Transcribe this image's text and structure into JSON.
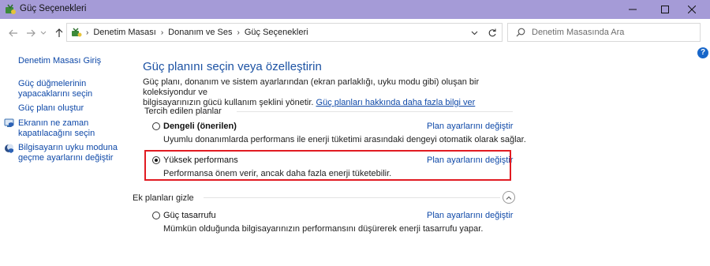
{
  "window": {
    "title": "Güç Seçenekleri"
  },
  "nav": {
    "breadcrumbs": [
      "Denetim Masası",
      "Donanım ve Ses",
      "Güç Seçenekleri"
    ],
    "search_placeholder": "Denetim Masasında Ara"
  },
  "sidebar": {
    "home": "Denetim Masası Giriş",
    "items": [
      {
        "line1": "Güç düğmelerinin",
        "line2": "yapacaklarını seçin"
      },
      {
        "line1": "Güç planı oluştur",
        "line2": ""
      },
      {
        "line1": "Ekranın ne zaman",
        "line2": "kapatılacağını seçin"
      },
      {
        "line1": "Bilgisayarın uyku moduna",
        "line2": "geçme ayarlarını değiştir"
      }
    ]
  },
  "main": {
    "title": "Güç planını seçin veya özelleştirin",
    "desc_line1": "Güç planı, donanım ve sistem ayarlarından (ekran parlaklığı, uyku modu gibi) oluşan bir koleksiyondur ve",
    "desc_line2": "bilgisayarınızın gücü kullanım şeklini yönetir.",
    "desc_link": "Güç planları hakkında daha fazla bilgi ver",
    "preferred_label": "Tercih edilen planlar",
    "extra_label": "Ek planları gizle",
    "change_label": "Plan ayarlarını değiştir",
    "plans": [
      {
        "name": "Dengeli (önerilen)",
        "desc": "Uyumlu donanımlarda performans ile enerji tüketimi arasındaki dengeyi otomatik olarak sağlar.",
        "selected": false
      },
      {
        "name": "Yüksek performans",
        "desc": "Performansa önem verir, ancak daha fazla enerji tüketebilir.",
        "selected": true
      },
      {
        "name": "Güç tasarrufu",
        "desc": "Mümkün olduğunda bilgisayarınızın performansını düşürerek enerji tasarrufu yapar.",
        "selected": false
      }
    ]
  },
  "colors": {
    "titlebar": "#a59bd7",
    "link": "#0f49a8",
    "title": "#1c52a3",
    "highlight": "#e11b22"
  }
}
